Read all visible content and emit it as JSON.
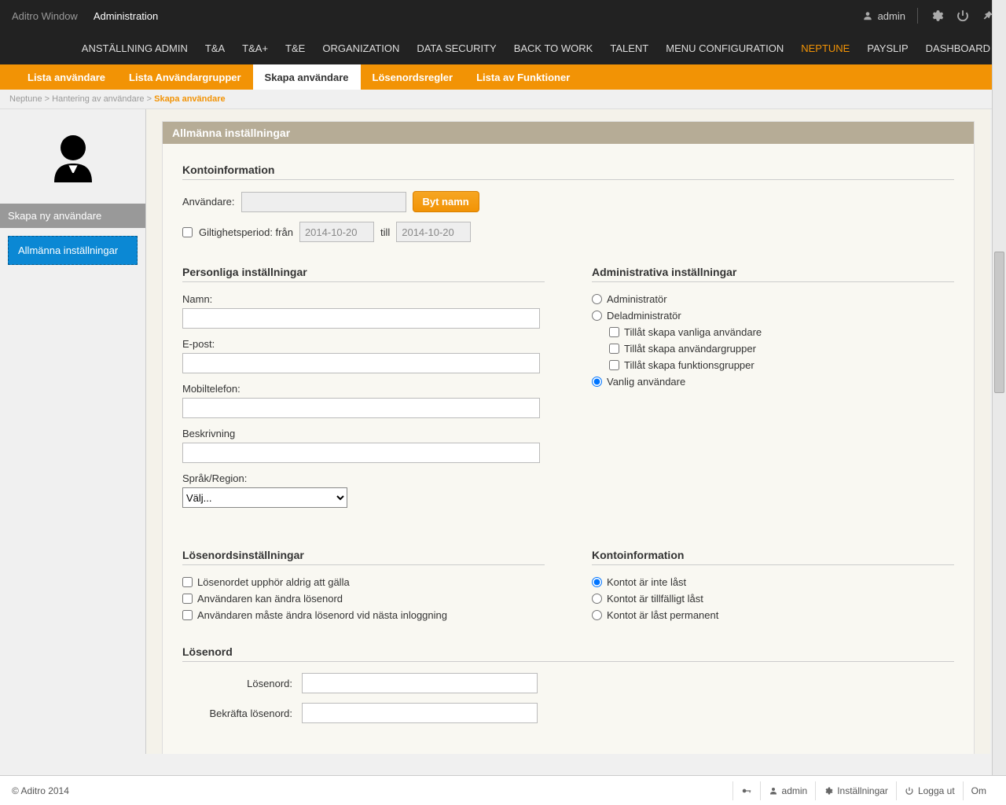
{
  "topbar": {
    "window_title": "Aditro Window",
    "section_title": "Administration",
    "user_label": "admin"
  },
  "topnav": {
    "items": [
      {
        "label": "ANSTÄLLNING ADMIN",
        "active": false
      },
      {
        "label": "T&A",
        "active": false
      },
      {
        "label": "T&A+",
        "active": false
      },
      {
        "label": "T&E",
        "active": false
      },
      {
        "label": "ORGANIZATION",
        "active": false
      },
      {
        "label": "DATA SECURITY",
        "active": false
      },
      {
        "label": "BACK TO WORK",
        "active": false
      },
      {
        "label": "TALENT",
        "active": false
      },
      {
        "label": "MENU CONFIGURATION",
        "active": false
      },
      {
        "label": "NEPTUNE",
        "active": true
      },
      {
        "label": "PAYSLIP",
        "active": false
      },
      {
        "label": "DASHBOARD",
        "active": false
      }
    ]
  },
  "orange_tabs": {
    "items": [
      {
        "label": "Lista användare",
        "active": false
      },
      {
        "label": "Lista Användargrupper",
        "active": false
      },
      {
        "label": "Skapa användare",
        "active": true
      },
      {
        "label": "Lösenordsregler",
        "active": false
      },
      {
        "label": "Lista av Funktioner",
        "active": false
      }
    ]
  },
  "breadcrumb": {
    "p1": "Neptune",
    "p2": "Hantering av användare",
    "current": "Skapa användare",
    "sep": " > "
  },
  "sidebar": {
    "title": "Skapa ny användare",
    "item1": "Allmänna inställningar"
  },
  "panel": {
    "header": "Allmänna inställningar",
    "account_info_title": "Kontoinformation",
    "user_label": "Användare:",
    "user_value": "",
    "rename_btn": "Byt namn",
    "validity_label": "Giltighetsperiod: från",
    "validity_till": "till",
    "date_from": "2014-10-20",
    "date_to": "2014-10-20",
    "personal_title": "Personliga inställningar",
    "name_label": "Namn:",
    "email_label": "E-post:",
    "mobile_label": "Mobiltelefon:",
    "desc_label": "Beskrivning",
    "lang_label": "Språk/Region:",
    "lang_placeholder": "Välj...",
    "admin_title": "Administrativa inställningar",
    "admin_opt": "Administratör",
    "partadmin_opt": "Deladministratör",
    "allow_users": "Tillåt skapa vanliga användare",
    "allow_groups": "Tillåt skapa användargrupper",
    "allow_funcgroups": "Tillåt skapa funktionsgrupper",
    "normal_user_opt": "Vanlig användare",
    "pw_settings_title": "Lösenordsinställningar",
    "pw_never": "Lösenordet upphör aldrig att gälla",
    "pw_can_change": "Användaren kan ändra lösenord",
    "pw_must_change": "Användaren måste ändra lösenord vid nästa inloggning",
    "account_info2_title": "Kontoinformation",
    "acct_not_locked": "Kontot är inte låst",
    "acct_temp_locked": "Kontot är tillfälligt låst",
    "acct_perm_locked": "Kontot är låst permanent",
    "password_title": "Lösenord",
    "pw_label": "Lösenord:",
    "pw_confirm_label": "Bekräfta lösenord:"
  },
  "footer": {
    "copyright": "© Aditro 2014",
    "admin": "admin",
    "settings": "Inställningar",
    "logout": "Logga ut",
    "about": "Om"
  }
}
